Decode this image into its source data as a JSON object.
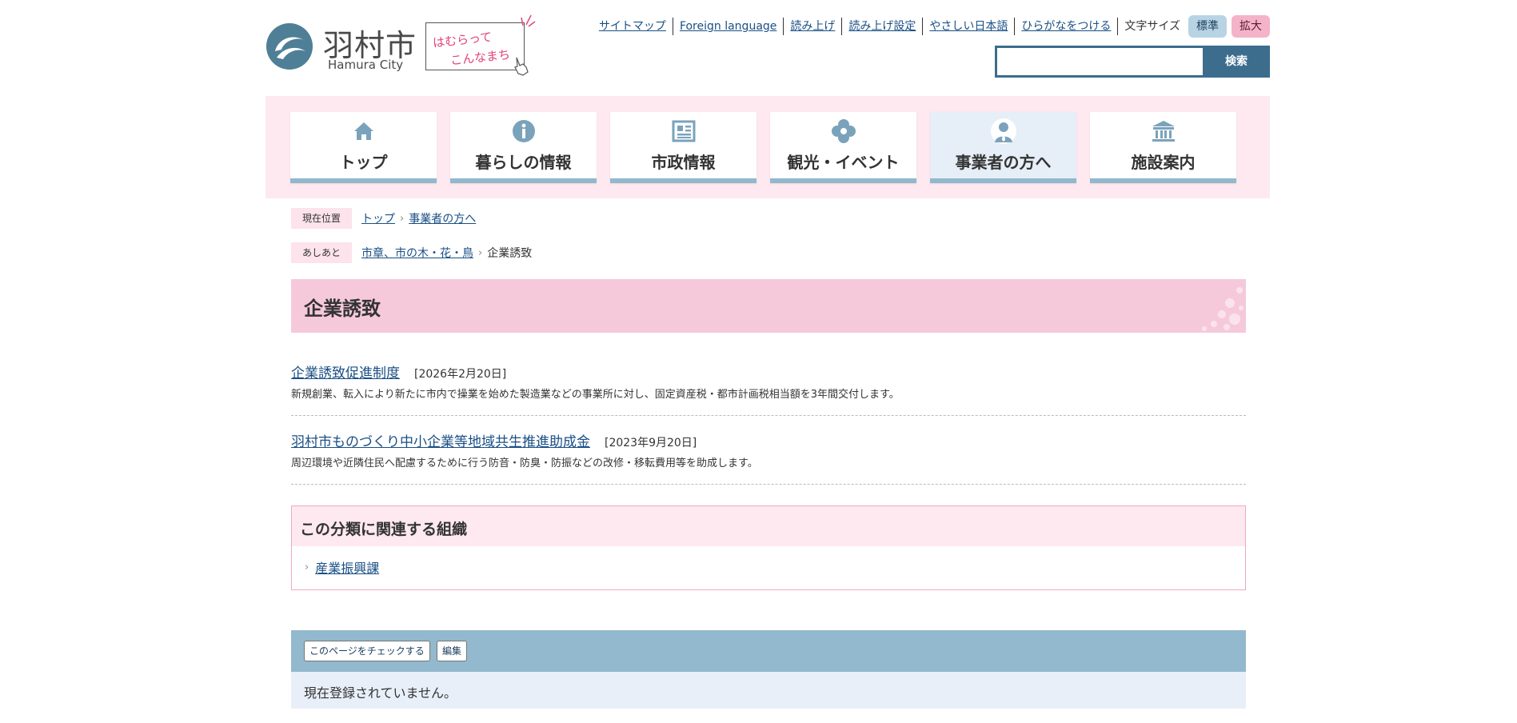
{
  "header": {
    "logo_ja": "羽村市",
    "logo_en": "Hamura City",
    "tagline_line1": "はむらって",
    "tagline_line2": "こんなまち",
    "util_links": [
      "サイトマップ",
      "Foreign language",
      "読み上げ",
      "読み上げ設定",
      "やさしい日本語",
      "ひらがなをつける"
    ],
    "font_size_label": "文字サイズ",
    "font_size_standard": "標準",
    "font_size_large": "拡大",
    "search_value": "",
    "search_button": "検索"
  },
  "gnav": {
    "items": [
      {
        "label": "トップ",
        "icon": "home-icon"
      },
      {
        "label": "暮らしの情報",
        "icon": "info-icon"
      },
      {
        "label": "市政情報",
        "icon": "newspaper-icon"
      },
      {
        "label": "観光・イベント",
        "icon": "flower-icon"
      },
      {
        "label": "事業者の方へ",
        "icon": "businessperson-icon",
        "active": true
      },
      {
        "label": "施設案内",
        "icon": "building-icon"
      }
    ]
  },
  "breadcrumb": {
    "current_label": "現在位置",
    "current_path": [
      "トップ",
      "事業者の方へ"
    ],
    "history_label": "あしあと",
    "history_path": [
      "市章、市の木・花・鳥"
    ],
    "history_current": "企業誘致"
  },
  "page": {
    "title": "企業誘致"
  },
  "entries": [
    {
      "title": "企業誘致促進制度",
      "date": "[2026年2月20日]",
      "description": "新規創業、転入により新たに市内で操業を始めた製造業などの事業所に対し、固定資産税・都市計画税相当額を3年間交付します。"
    },
    {
      "title": "羽村市ものづくり中小企業等地域共生推進助成金",
      "date": "[2023年9月20日]",
      "description": "周辺環境や近隣住民へ配慮するために行う防音・防臭・防振などの改修・移転費用等を助成します。"
    }
  ],
  "related": {
    "heading": "この分類に関連する組織",
    "items": [
      "産業振興課"
    ]
  },
  "check": {
    "check_button": "このページをチェックする",
    "edit_button": "編集",
    "message": "現在登録されていません。"
  },
  "colors": {
    "accent_pink": "#f6c9da",
    "nav_bg": "#fde9ef",
    "nav_underline": "#91b8cc",
    "search_blue": "#3c6d8d",
    "link": "#1a4f85"
  }
}
